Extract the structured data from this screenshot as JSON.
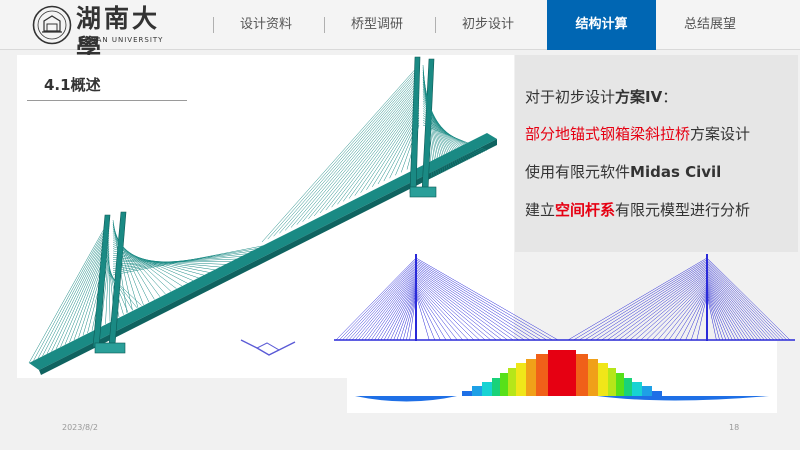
{
  "header": {
    "logo_cn": "湖南大學",
    "logo_en": "HUNAN UNIVERSITY",
    "nav": [
      {
        "label": "设计资料",
        "active": false
      },
      {
        "label": "桥型调研",
        "active": false
      },
      {
        "label": "初步设计",
        "active": false
      },
      {
        "label": "结构计算",
        "active": true
      },
      {
        "label": "总结展望",
        "active": false
      }
    ],
    "active_color": "#0066b3"
  },
  "section": {
    "title": "4.1概述"
  },
  "content": {
    "line1": {
      "pre": "对于初步设计",
      "bold": "方案IV",
      "post": "："
    },
    "line2": {
      "red": "部分地锚式钢箱梁斜拉桥",
      "post": "方案设计"
    },
    "line3": {
      "pre": "使用有限元软件",
      "bold": "Midas Civil"
    },
    "line4": {
      "pre": "建立",
      "red_bold": "空间杆系",
      "post": "有限元模型进行分析"
    }
  },
  "footer": {
    "date": "2023/8/2",
    "page": "18"
  },
  "colors": {
    "model_teal": "#1a8a84",
    "model_blue": "#2a2ad8",
    "highlight_red": "#e60012"
  }
}
